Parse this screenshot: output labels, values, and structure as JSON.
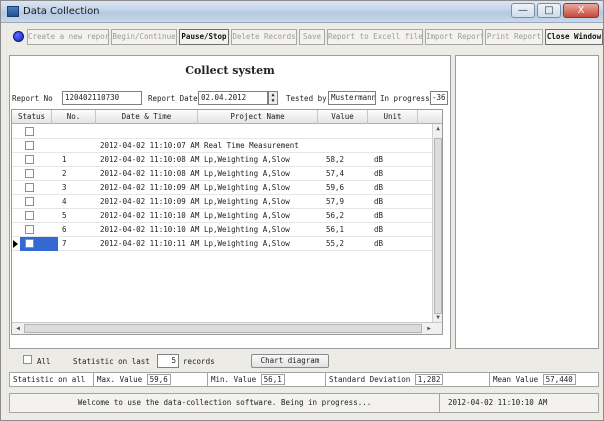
{
  "window": {
    "title": "Data Collection",
    "controls": {
      "minimize": "—",
      "maximize": "□",
      "close": "X"
    }
  },
  "toolbar": {
    "buttons": [
      {
        "label": "Create a new report",
        "enabled": false
      },
      {
        "label": "Begin/Continue",
        "enabled": false
      },
      {
        "label": "Pause/Stop",
        "enabled": true
      },
      {
        "label": "Delete Records",
        "enabled": false
      },
      {
        "label": "Save",
        "enabled": false
      },
      {
        "label": "Report to Excell file",
        "enabled": false
      },
      {
        "label": "Import Report",
        "enabled": false
      },
      {
        "label": "Print Report",
        "enabled": false
      },
      {
        "label": "Close Window",
        "enabled": true
      }
    ]
  },
  "main": {
    "heading": "Collect system",
    "report_no_label": "Report No",
    "report_no_value": "120402110730",
    "report_date_label": "Report Date",
    "report_date_value": "02.04.2012",
    "tested_by_label": "Tested by",
    "tested_by_value": "Mustermann",
    "in_progress_label": "In progress",
    "in_progress_value": "-36",
    "table": {
      "columns": [
        "Status",
        "No.",
        "Date & Time",
        "Project Name",
        "Value",
        "Unit"
      ],
      "rows": [
        {
          "no": "",
          "datetime": "",
          "project": "",
          "value": "",
          "unit": ""
        },
        {
          "no": "",
          "datetime": "2012-04-02 11:10:07 AM",
          "project": "Real Time Measurement",
          "value": "",
          "unit": ""
        },
        {
          "no": "1",
          "datetime": "2012-04-02 11:10:08 AM",
          "project": "Lp,Weighting A,Slow",
          "value": "58,2",
          "unit": "dB"
        },
        {
          "no": "2",
          "datetime": "2012-04-02 11:10:08 AM",
          "project": "Lp,Weighting A,Slow",
          "value": "57,4",
          "unit": "dB"
        },
        {
          "no": "3",
          "datetime": "2012-04-02 11:10:09 AM",
          "project": "Lp,Weighting A,Slow",
          "value": "59,6",
          "unit": "dB"
        },
        {
          "no": "4",
          "datetime": "2012-04-02 11:10:09 AM",
          "project": "Lp,Weighting A,Slow",
          "value": "57,9",
          "unit": "dB"
        },
        {
          "no": "5",
          "datetime": "2012-04-02 11:10:10 AM",
          "project": "Lp,Weighting A,Slow",
          "value": "56,2",
          "unit": "dB"
        },
        {
          "no": "6",
          "datetime": "2012-04-02 11:10:10 AM",
          "project": "Lp,Weighting A,Slow",
          "value": "56,1",
          "unit": "dB"
        },
        {
          "no": "7",
          "datetime": "2012-04-02 11:10:11 AM",
          "project": "Lp,Weighting A,Slow",
          "value": "55,2",
          "unit": "dB"
        }
      ],
      "selected_row": 8
    }
  },
  "stats": {
    "all_label": "All",
    "statistic_label": "Statistic on last",
    "records_count": "5",
    "records_label": "records",
    "chart_button": "Chart diagram",
    "statistic_on_all": "Statistic on all",
    "max_label": "Max. Value",
    "max_value": "59,6",
    "min_label": "Min. Value",
    "min_value": "56,1",
    "std_label": "Standard Deviation",
    "std_value": "1,282",
    "mean_label": "Mean Value",
    "mean_value": "57,440"
  },
  "status": {
    "message": "Welcome to use the data-collection software. Being in progress...",
    "timestamp": "2012-04-02 11:10:10 AM"
  }
}
